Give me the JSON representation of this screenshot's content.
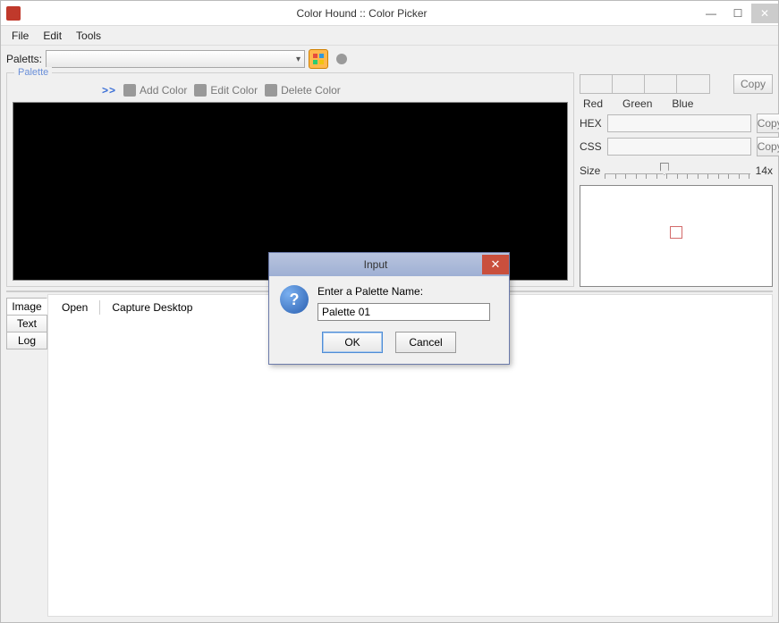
{
  "window": {
    "title": "Color Hound :: Color Picker"
  },
  "menu": {
    "file": "File",
    "edit": "Edit",
    "tools": "Tools"
  },
  "toolbar": {
    "paletts_label": "Paletts:"
  },
  "palette": {
    "group_title": "Palette",
    "arrows": ">>",
    "add": "Add Color",
    "edit": "Edit Color",
    "delete": "Delete Color"
  },
  "side": {
    "copy": "Copy",
    "red": "Red",
    "green": "Green",
    "blue": "Blue",
    "hex": "HEX",
    "css": "CSS",
    "size": "Size",
    "zoom": "14x"
  },
  "lower": {
    "tab_image": "Image",
    "tab_text": "Text",
    "tab_log": "Log",
    "open": "Open",
    "capture": "Capture Desktop"
  },
  "dialog": {
    "title": "Input",
    "prompt": "Enter a Palette Name:",
    "value": "Palette 01",
    "ok": "OK",
    "cancel": "Cancel"
  }
}
